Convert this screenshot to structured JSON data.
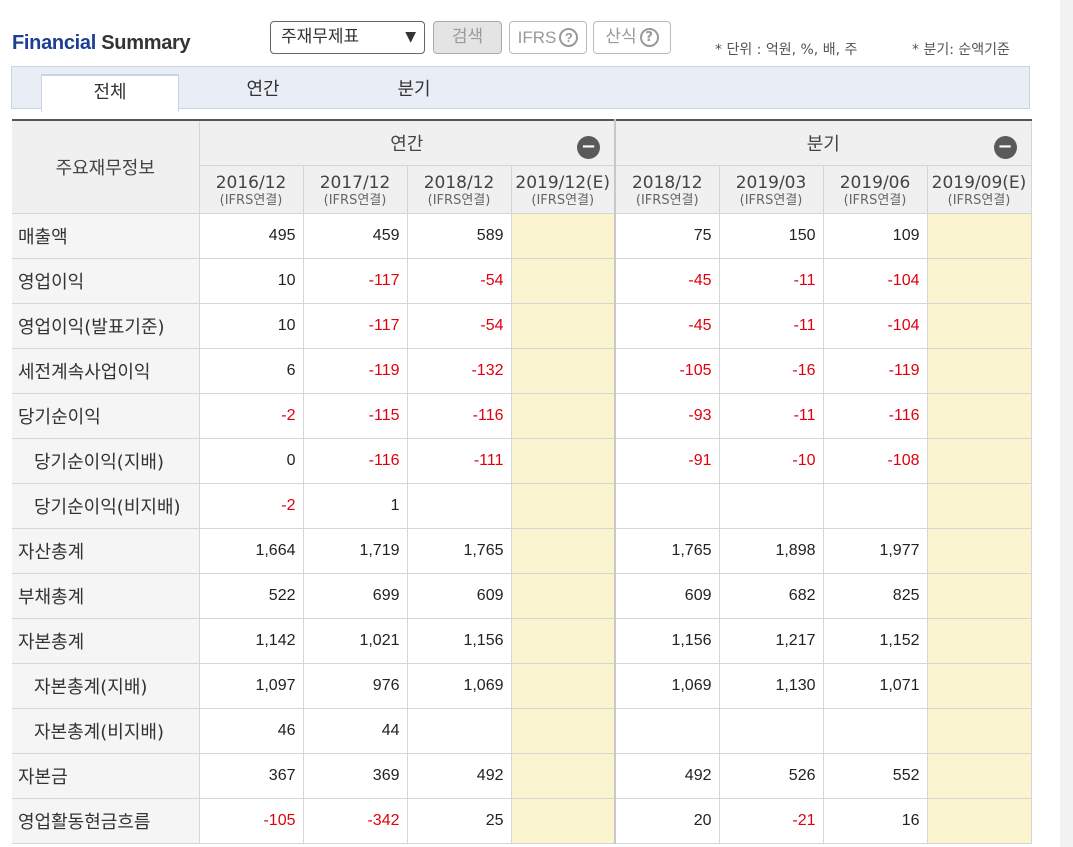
{
  "header": {
    "title_part1": "Financial",
    "title_part2": "Summary",
    "select_value": "주재무제표",
    "select_arrow": "▼",
    "search_label": "검색",
    "ifrs_label": "IFRS",
    "calc_label": "산식",
    "help_glyph": "?",
    "unit_note": "* 단위 : 억원, %, 배, 주",
    "quarter_note": "* 분기: 순액기준"
  },
  "tabs": {
    "all": "전체",
    "annual": "연간",
    "quarter": "분기"
  },
  "table": {
    "corner": "주요재무정보",
    "group_annual": "연간",
    "group_quarter": "분기",
    "toggle_glyph": "−",
    "periods": [
      {
        "date": "2016/12",
        "sub": "(IFRS연결)"
      },
      {
        "date": "2017/12",
        "sub": "(IFRS연결)"
      },
      {
        "date": "2018/12",
        "sub": "(IFRS연결)"
      },
      {
        "date": "2019/12(E)",
        "sub": "(IFRS연결)"
      },
      {
        "date": "2018/12",
        "sub": "(IFRS연결)"
      },
      {
        "date": "2019/03",
        "sub": "(IFRS연결)"
      },
      {
        "date": "2019/06",
        "sub": "(IFRS연결)"
      },
      {
        "date": "2019/09(E)",
        "sub": "(IFRS연결)"
      }
    ],
    "rows": [
      {
        "label": "매출액",
        "sub": false,
        "values": [
          "495",
          "459",
          "589",
          "",
          "75",
          "150",
          "109",
          ""
        ]
      },
      {
        "label": "영업이익",
        "sub": false,
        "values": [
          "10",
          "-117",
          "-54",
          "",
          "-45",
          "-11",
          "-104",
          ""
        ]
      },
      {
        "label": "영업이익(발표기준)",
        "sub": false,
        "values": [
          "10",
          "-117",
          "-54",
          "",
          "-45",
          "-11",
          "-104",
          ""
        ]
      },
      {
        "label": "세전계속사업이익",
        "sub": false,
        "values": [
          "6",
          "-119",
          "-132",
          "",
          "-105",
          "-16",
          "-119",
          ""
        ]
      },
      {
        "label": "당기순이익",
        "sub": false,
        "values": [
          "-2",
          "-115",
          "-116",
          "",
          "-93",
          "-11",
          "-116",
          ""
        ]
      },
      {
        "label": "당기순이익(지배)",
        "sub": true,
        "values": [
          "0",
          "-116",
          "-111",
          "",
          "-91",
          "-10",
          "-108",
          ""
        ]
      },
      {
        "label": "당기순이익(비지배)",
        "sub": true,
        "values": [
          "-2",
          "1",
          "",
          "",
          "",
          "",
          "",
          ""
        ]
      },
      {
        "label": "자산총계",
        "sub": false,
        "values": [
          "1,664",
          "1,719",
          "1,765",
          "",
          "1,765",
          "1,898",
          "1,977",
          ""
        ]
      },
      {
        "label": "부채총계",
        "sub": false,
        "values": [
          "522",
          "699",
          "609",
          "",
          "609",
          "682",
          "825",
          ""
        ]
      },
      {
        "label": "자본총계",
        "sub": false,
        "values": [
          "1,142",
          "1,021",
          "1,156",
          "",
          "1,156",
          "1,217",
          "1,152",
          ""
        ]
      },
      {
        "label": "자본총계(지배)",
        "sub": true,
        "values": [
          "1,097",
          "976",
          "1,069",
          "",
          "1,069",
          "1,130",
          "1,071",
          ""
        ]
      },
      {
        "label": "자본총계(비지배)",
        "sub": true,
        "values": [
          "46",
          "44",
          "",
          "",
          "",
          "",
          "",
          ""
        ]
      },
      {
        "label": "자본금",
        "sub": false,
        "values": [
          "367",
          "369",
          "492",
          "",
          "492",
          "526",
          "552",
          ""
        ]
      },
      {
        "label": "영업활동현금흐름",
        "sub": false,
        "values": [
          "-105",
          "-342",
          "25",
          "",
          "20",
          "-21",
          "16",
          ""
        ]
      }
    ]
  },
  "colors": {
    "title_blue": "#1c3e94",
    "negative_red": "#e0000e",
    "estimate_bg": "#fbf5cf",
    "tab_bar_bg": "#e9eef6"
  }
}
